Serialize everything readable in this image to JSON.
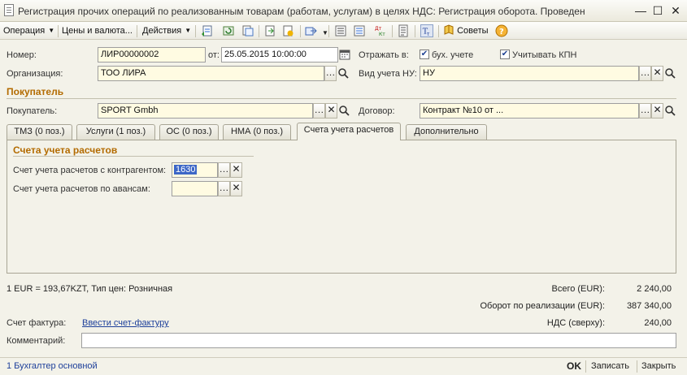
{
  "window": {
    "title": "Регистрация прочих операций по реализованным товарам (работам, услугам) в целях НДС: Регистрация оборота. Проведен",
    "minimize": "—",
    "maximize": "☐",
    "close": "✕"
  },
  "toolbar": {
    "operation": "Операция",
    "prices": "Цены и валюта...",
    "actions": "Действия",
    "tips": "Советы"
  },
  "form": {
    "number_label": "Номер:",
    "number_value": "ЛИР00000002",
    "date_label": "от:",
    "date_value": "25.05.2015 10:00:00",
    "reflect_label": "Отражать в:",
    "buh_label": "бух. учете",
    "kpn_label": "Учитывать КПН",
    "org_label": "Организация:",
    "org_value": "ТОО ЛИРА",
    "nu_label": "Вид учета НУ:",
    "nu_value": "НУ",
    "buyer_section": "Покупатель",
    "buyer_label": "Покупатель:",
    "buyer_value": "SPORT Gmbh",
    "contract_label": "Договор:",
    "contract_value": "Контракт №10 от ..."
  },
  "tabs": [
    {
      "label": "ТМЗ (0 поз.)"
    },
    {
      "label": "Услуги (1 поз.)"
    },
    {
      "label": "ОС (0 поз.)"
    },
    {
      "label": "НМА (0 поз.)"
    },
    {
      "label": "Счета учета расчетов"
    },
    {
      "label": "Дополнительно"
    }
  ],
  "accounts": {
    "section": "Счета учета расчетов",
    "contractor_label": "Счет учета расчетов с контрагентом:",
    "contractor_value": "1630",
    "advance_label": "Счет учета расчетов по авансам:",
    "advance_value": ""
  },
  "footer": {
    "rate": "1 EUR = 193,67KZT, Тип цен: Розничная",
    "total_label": "Всего (EUR):",
    "total_value": "2 240,00",
    "turnover_label": "Оборот по реализации (EUR):",
    "turnover_value": "387 340,00",
    "vat_label": "НДС (сверху):",
    "vat_value": "240,00",
    "invoice_label": "Счет фактура:",
    "invoice_link": "Ввести счет-фактуру",
    "comment_label": "Комментарий:",
    "comment_value": ""
  },
  "status": {
    "user": "1 Бухгалтер основной",
    "ok": "OK",
    "save": "Записать",
    "close": "Закрыть"
  },
  "colors": {
    "accent_orange": "#b36b00",
    "link_blue": "#1d3f9a",
    "selection_blue": "#3d67c7"
  }
}
